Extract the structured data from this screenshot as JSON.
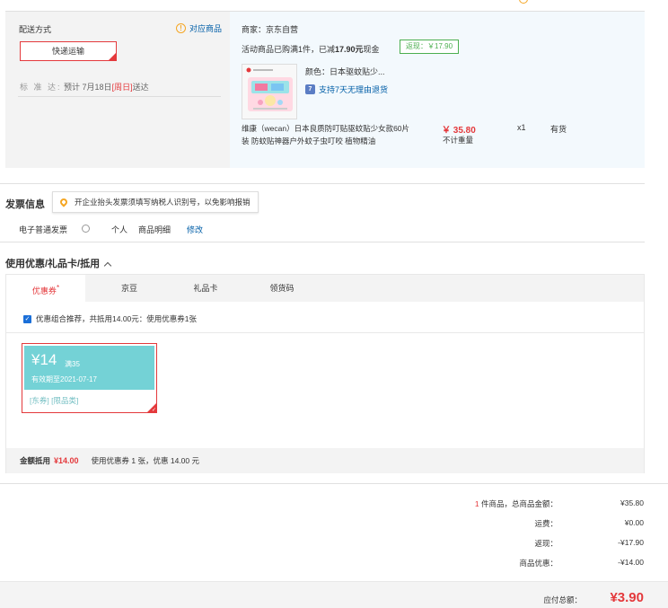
{
  "delivery": {
    "title": "配送方式",
    "link_label": "对应商品",
    "method_label": "快递运输",
    "est_label": "标 准 达:",
    "est_prefix": "预计 7月18日",
    "est_day": "[周日]",
    "est_suffix": "送达"
  },
  "shop": {
    "name": "商家：京东自营",
    "promo_prefix": "活动商品已购满1件，已减",
    "promo_amount": "17.90元",
    "promo_suffix": "现金",
    "rebate_tag": "返现：￥17.90"
  },
  "product": {
    "color": "颜色：日本驱蚊贴少...",
    "return_badge": "7",
    "return_text": "支持7天无理由退货",
    "name": "维康（wecan）日本良质防叮贴驱蚊贴少女款60片装 防蚊贴神器户外蚊子虫叮咬 植物精油",
    "price": "￥ 35.80",
    "weight": "不计重量",
    "qty": "x1",
    "stock": "有货"
  },
  "invoice": {
    "title": "发票信息",
    "tip": "开企业抬头发票须填写纳税人识别号，以免影响报销",
    "type": "电子普通发票",
    "person": "个人",
    "detail": "商品明细",
    "edit": "修改"
  },
  "coupons": {
    "title": "使用优惠/礼品卡/抵用",
    "tabs": [
      "优惠券",
      "京豆",
      "礼品卡",
      "领货码"
    ],
    "recommend": "优惠组合推荐，共抵用14.00元：使用优惠券1张",
    "card": {
      "amount": "¥14",
      "condition": "满35",
      "valid": "有效期至2021-07-17",
      "tags": "[东券] [限品类]"
    },
    "footer_label": "金额抵用",
    "footer_amount": "¥14.00",
    "footer_detail": "使用优惠券 1 张，优惠 14.00 元"
  },
  "summary": {
    "count": "1",
    "count_label": "件商品，总商品金额：",
    "goods_total": "¥35.80",
    "shipping_label": "运费：",
    "shipping": "¥0.00",
    "rebate_label": "返现：",
    "rebate": "-¥17.90",
    "discount_label": "商品优惠：",
    "discount": "-¥14.00",
    "payable_label": "应付总额：",
    "payable": "¥3.90"
  },
  "colors": {
    "accent_red": "#e4393c",
    "link_blue": "#005ea7",
    "coupon_teal": "#74d2d6",
    "rebate_green": "#4caf50"
  }
}
